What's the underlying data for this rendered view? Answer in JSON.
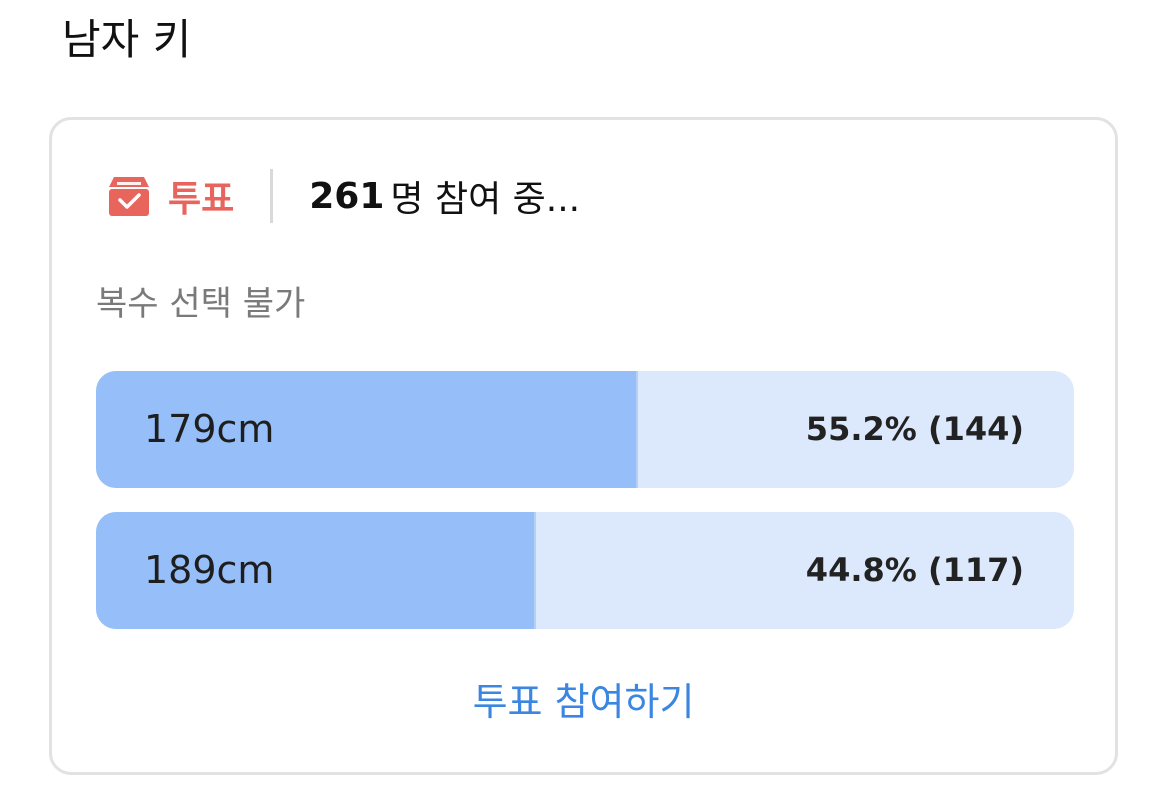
{
  "page": {
    "title": "남자 키"
  },
  "poll": {
    "badge_label": "투표",
    "badge_icon": "ballot-box-icon",
    "accent_color": "#e8655e",
    "participant_count": "261",
    "participant_suffix": "명 참여 중...",
    "rule": "복수 선택 불가",
    "options": [
      {
        "label": "179cm",
        "percent": 55.2,
        "result_text": "55.2% (144)",
        "votes": 144
      },
      {
        "label": "189cm",
        "percent": 44.8,
        "result_text": "44.8% (117)",
        "votes": 117
      }
    ],
    "fill_color": "#96bef8",
    "track_color": "#dce9fc",
    "join_label": "투표 참여하기",
    "join_color": "#3a86e0"
  }
}
